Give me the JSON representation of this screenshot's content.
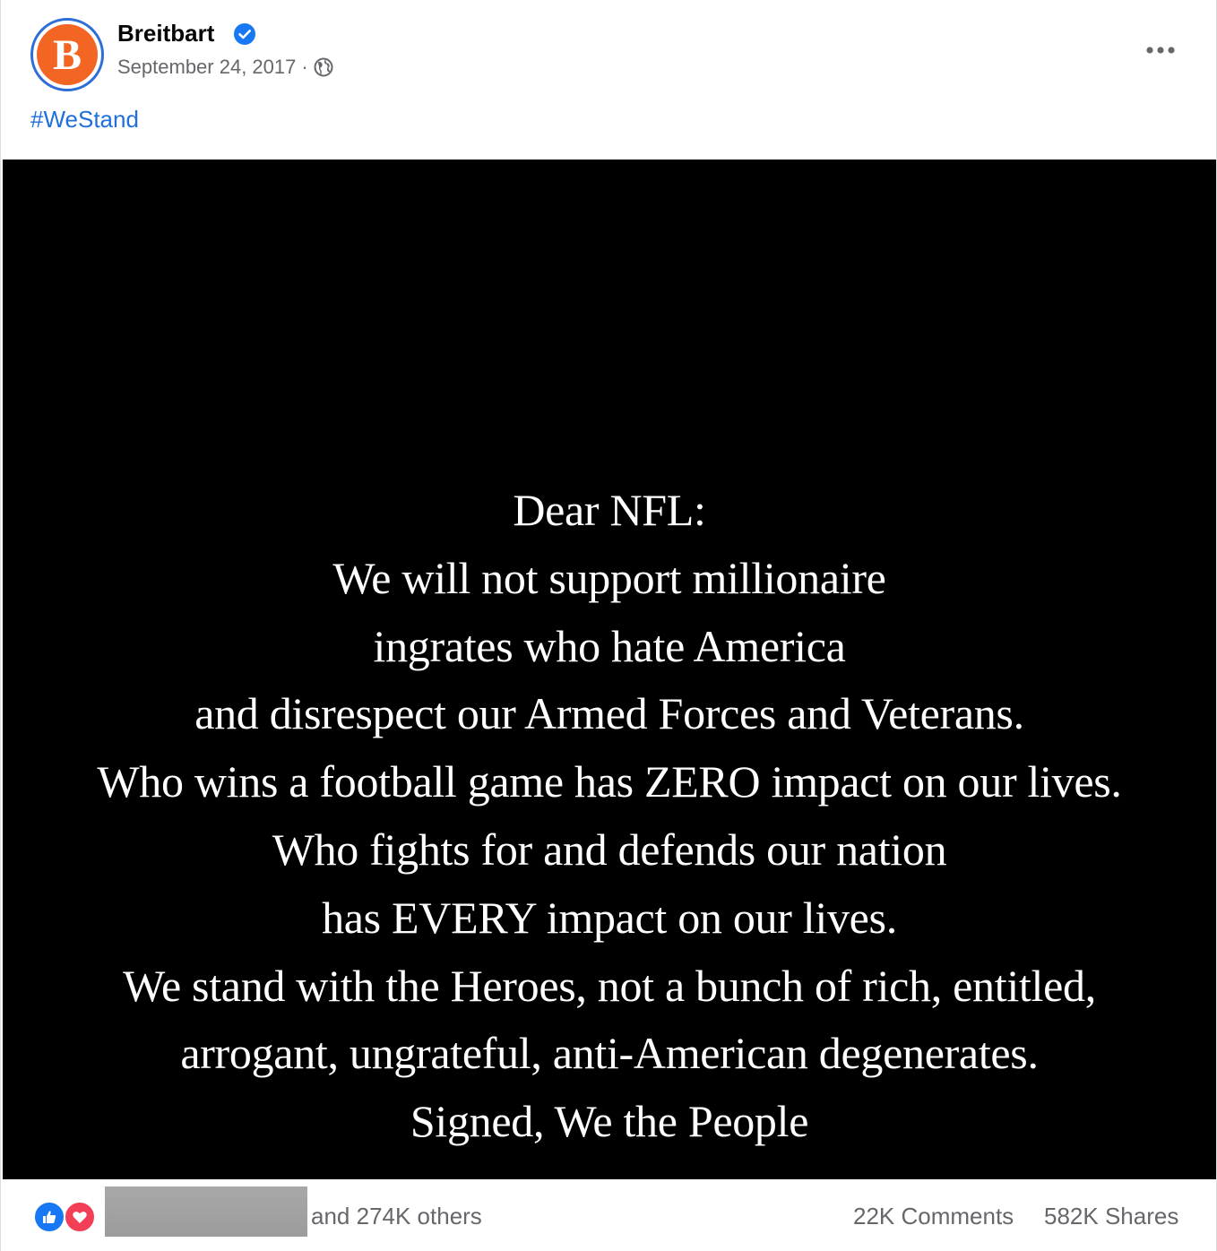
{
  "post": {
    "author": "Breitbart",
    "avatar_letter": "B",
    "verified": true,
    "date": "September 24, 2017",
    "separator": "·",
    "audience_icon": "globe-icon",
    "more_icon": "more-options-icon",
    "hashtag": "#WeStand"
  },
  "image_text": {
    "lines": [
      "Dear NFL:",
      "We will not support millionaire",
      "ingrates who hate America",
      "and disrespect our Armed Forces and Veterans.",
      "Who wins a football game has ZERO impact on our lives.",
      "Who fights for and defends our nation",
      "has EVERY impact on our lives.",
      "We stand with the Heroes, not a bunch of rich, entitled,",
      "arrogant, ungrateful, anti-American degenerates.",
      "Signed, We the People"
    ]
  },
  "footer": {
    "reaction_icons": [
      "like-icon",
      "love-icon"
    ],
    "others_text": "and 274K others",
    "comments": "22K Comments",
    "shares": "582K Shares"
  },
  "colors": {
    "brand_orange": "#f26522",
    "link_blue": "#216fdb",
    "verified_blue": "#1877f2",
    "secondary_text": "#65676b",
    "like_blue": "#1877f2",
    "love_red": "#f33e58"
  }
}
